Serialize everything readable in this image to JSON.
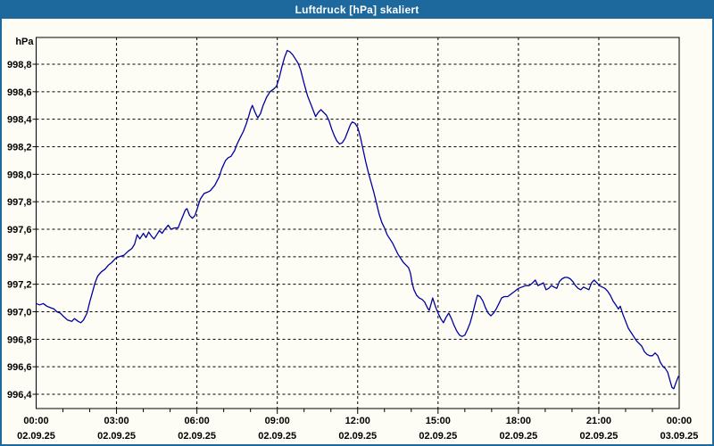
{
  "window": {
    "title": "Luftdruck [hPa] skaliert",
    "title_bar_color": "#1d699e",
    "title_text_color": "#ffffff",
    "border_color": "#1d699e",
    "background_color": "#fdfdf5"
  },
  "chart_data": {
    "type": "line",
    "title": "Luftdruck [hPa] skaliert",
    "unit_label": "hPa",
    "grid": {
      "style": "dashed",
      "color": "#000000",
      "axis_color": "#000000"
    },
    "x_axis": {
      "range_hours": [
        0,
        24
      ],
      "major_tick_hours": 3,
      "minor_tick_hours": 1,
      "ticks": [
        {
          "t": 0,
          "time": "00:00",
          "date": "02.09.25"
        },
        {
          "t": 3,
          "time": "03:00",
          "date": "02.09.25"
        },
        {
          "t": 6,
          "time": "06:00",
          "date": "02.09.25"
        },
        {
          "t": 9,
          "time": "09:00",
          "date": "02.09.25"
        },
        {
          "t": 12,
          "time": "12:00",
          "date": "02.09.25"
        },
        {
          "t": 15,
          "time": "15:00",
          "date": "02.09.25"
        },
        {
          "t": 18,
          "time": "18:00",
          "date": "02.09.25"
        },
        {
          "t": 21,
          "time": "21:00",
          "date": "02.09.25"
        },
        {
          "t": 24,
          "time": "00:00",
          "date": "03.09.25"
        }
      ]
    },
    "y_axis": {
      "grid_min": 996.4,
      "grid_max": 998.8,
      "step": 0.2,
      "plot_top_value": 999.0,
      "plot_bottom_value": 996.3,
      "ticks": [
        {
          "v": 998.8,
          "label": "998,8"
        },
        {
          "v": 998.6,
          "label": "998,6"
        },
        {
          "v": 998.4,
          "label": "998,4"
        },
        {
          "v": 998.2,
          "label": "998,2"
        },
        {
          "v": 998.0,
          "label": "998,0"
        },
        {
          "v": 997.8,
          "label": "997,8"
        },
        {
          "v": 997.6,
          "label": "997,6"
        },
        {
          "v": 997.4,
          "label": "997,4"
        },
        {
          "v": 997.2,
          "label": "997,2"
        },
        {
          "v": 997.0,
          "label": "997,0"
        },
        {
          "v": 996.8,
          "label": "996,8"
        },
        {
          "v": 996.6,
          "label": "996,6"
        },
        {
          "v": 996.4,
          "label": "996,4"
        }
      ]
    },
    "series": [
      {
        "name": "Luftdruck",
        "color": "#0000a0",
        "points": [
          [
            0.0,
            997.06
          ],
          [
            0.13,
            997.05
          ],
          [
            0.27,
            997.06
          ],
          [
            0.4,
            997.04
          ],
          [
            0.53,
            997.03
          ],
          [
            0.67,
            997.02
          ],
          [
            0.77,
            997.0
          ],
          [
            0.9,
            996.99
          ],
          [
            1.0,
            996.97
          ],
          [
            1.17,
            996.94
          ],
          [
            1.33,
            996.93
          ],
          [
            1.43,
            996.95
          ],
          [
            1.57,
            996.93
          ],
          [
            1.67,
            996.92
          ],
          [
            1.77,
            996.94
          ],
          [
            1.9,
            996.99
          ],
          [
            2.0,
            997.07
          ],
          [
            2.1,
            997.14
          ],
          [
            2.2,
            997.21
          ],
          [
            2.3,
            997.26
          ],
          [
            2.43,
            997.29
          ],
          [
            2.57,
            997.31
          ],
          [
            2.7,
            997.34
          ],
          [
            2.83,
            997.36
          ],
          [
            2.97,
            997.39
          ],
          [
            3.1,
            997.4
          ],
          [
            3.27,
            997.41
          ],
          [
            3.43,
            997.44
          ],
          [
            3.57,
            997.46
          ],
          [
            3.67,
            997.49
          ],
          [
            3.77,
            997.56
          ],
          [
            3.87,
            997.53
          ],
          [
            4.0,
            997.57
          ],
          [
            4.1,
            997.54
          ],
          [
            4.2,
            997.58
          ],
          [
            4.3,
            997.55
          ],
          [
            4.4,
            997.53
          ],
          [
            4.5,
            997.56
          ],
          [
            4.6,
            997.59
          ],
          [
            4.7,
            997.57
          ],
          [
            4.8,
            997.6
          ],
          [
            4.93,
            997.63
          ],
          [
            5.03,
            997.6
          ],
          [
            5.17,
            997.61
          ],
          [
            5.3,
            997.61
          ],
          [
            5.4,
            997.66
          ],
          [
            5.57,
            997.74
          ],
          [
            5.63,
            997.75
          ],
          [
            5.73,
            997.7
          ],
          [
            5.83,
            997.68
          ],
          [
            5.93,
            997.7
          ],
          [
            6.03,
            997.76
          ],
          [
            6.13,
            997.82
          ],
          [
            6.27,
            997.86
          ],
          [
            6.4,
            997.87
          ],
          [
            6.5,
            997.88
          ],
          [
            6.67,
            997.92
          ],
          [
            6.83,
            997.98
          ],
          [
            6.93,
            998.04
          ],
          [
            7.07,
            998.1
          ],
          [
            7.17,
            998.12
          ],
          [
            7.27,
            998.13
          ],
          [
            7.4,
            998.17
          ],
          [
            7.5,
            998.22
          ],
          [
            7.6,
            998.26
          ],
          [
            7.73,
            998.31
          ],
          [
            7.83,
            998.36
          ],
          [
            7.93,
            998.42
          ],
          [
            8.0,
            998.47
          ],
          [
            8.07,
            998.5
          ],
          [
            8.17,
            998.45
          ],
          [
            8.27,
            998.41
          ],
          [
            8.37,
            998.44
          ],
          [
            8.47,
            998.5
          ],
          [
            8.6,
            998.56
          ],
          [
            8.73,
            998.6
          ],
          [
            8.87,
            998.62
          ],
          [
            8.97,
            998.64
          ],
          [
            9.07,
            998.7
          ],
          [
            9.17,
            998.78
          ],
          [
            9.27,
            998.85
          ],
          [
            9.37,
            998.9
          ],
          [
            9.47,
            998.89
          ],
          [
            9.57,
            998.87
          ],
          [
            9.67,
            998.84
          ],
          [
            9.77,
            998.81
          ],
          [
            9.87,
            998.76
          ],
          [
            10.0,
            998.66
          ],
          [
            10.13,
            998.57
          ],
          [
            10.27,
            998.5
          ],
          [
            10.37,
            998.45
          ],
          [
            10.43,
            998.42
          ],
          [
            10.53,
            998.45
          ],
          [
            10.63,
            998.47
          ],
          [
            10.73,
            998.45
          ],
          [
            10.83,
            998.43
          ],
          [
            10.93,
            998.39
          ],
          [
            11.03,
            998.33
          ],
          [
            11.13,
            998.28
          ],
          [
            11.23,
            998.24
          ],
          [
            11.33,
            998.22
          ],
          [
            11.43,
            998.23
          ],
          [
            11.53,
            998.26
          ],
          [
            11.63,
            998.31
          ],
          [
            11.73,
            998.36
          ],
          [
            11.8,
            998.38
          ],
          [
            11.9,
            998.37
          ],
          [
            12.0,
            998.34
          ],
          [
            12.1,
            998.27
          ],
          [
            12.2,
            998.18
          ],
          [
            12.3,
            998.09
          ],
          [
            12.4,
            998.01
          ],
          [
            12.5,
            997.94
          ],
          [
            12.6,
            997.87
          ],
          [
            12.7,
            997.79
          ],
          [
            12.8,
            997.71
          ],
          [
            12.9,
            997.65
          ],
          [
            13.0,
            997.61
          ],
          [
            13.1,
            997.56
          ],
          [
            13.2,
            997.53
          ],
          [
            13.3,
            997.5
          ],
          [
            13.4,
            997.46
          ],
          [
            13.5,
            997.42
          ],
          [
            13.6,
            997.39
          ],
          [
            13.7,
            997.36
          ],
          [
            13.8,
            997.34
          ],
          [
            13.9,
            997.32
          ],
          [
            13.97,
            997.28
          ],
          [
            14.03,
            997.21
          ],
          [
            14.1,
            997.16
          ],
          [
            14.2,
            997.12
          ],
          [
            14.3,
            997.1
          ],
          [
            14.4,
            997.09
          ],
          [
            14.5,
            997.07
          ],
          [
            14.6,
            997.03
          ],
          [
            14.67,
            997.01
          ],
          [
            14.73,
            997.05
          ],
          [
            14.8,
            997.1
          ],
          [
            14.9,
            997.04
          ],
          [
            15.0,
            996.99
          ],
          [
            15.1,
            996.95
          ],
          [
            15.2,
            996.92
          ],
          [
            15.3,
            996.96
          ],
          [
            15.4,
            996.99
          ],
          [
            15.5,
            996.95
          ],
          [
            15.6,
            996.9
          ],
          [
            15.7,
            996.86
          ],
          [
            15.8,
            996.83
          ],
          [
            15.9,
            996.82
          ],
          [
            16.0,
            996.83
          ],
          [
            16.1,
            996.87
          ],
          [
            16.2,
            996.92
          ],
          [
            16.3,
            996.99
          ],
          [
            16.4,
            997.07
          ],
          [
            16.47,
            997.12
          ],
          [
            16.57,
            997.11
          ],
          [
            16.67,
            997.08
          ],
          [
            16.77,
            997.03
          ],
          [
            16.87,
            996.99
          ],
          [
            16.97,
            996.97
          ],
          [
            17.07,
            996.99
          ],
          [
            17.17,
            997.02
          ],
          [
            17.27,
            997.06
          ],
          [
            17.37,
            997.1
          ],
          [
            17.47,
            997.11
          ],
          [
            17.6,
            997.11
          ],
          [
            17.73,
            997.13
          ],
          [
            17.87,
            997.15
          ],
          [
            18.0,
            997.17
          ],
          [
            18.13,
            997.18
          ],
          [
            18.27,
            997.19
          ],
          [
            18.4,
            997.19
          ],
          [
            18.53,
            997.21
          ],
          [
            18.63,
            997.23
          ],
          [
            18.73,
            997.19
          ],
          [
            18.83,
            997.2
          ],
          [
            18.93,
            997.21
          ],
          [
            19.03,
            997.16
          ],
          [
            19.13,
            997.17
          ],
          [
            19.23,
            997.19
          ],
          [
            19.33,
            997.18
          ],
          [
            19.43,
            997.17
          ],
          [
            19.53,
            997.22
          ],
          [
            19.63,
            997.24
          ],
          [
            19.73,
            997.25
          ],
          [
            19.83,
            997.25
          ],
          [
            19.93,
            997.24
          ],
          [
            20.03,
            997.22
          ],
          [
            20.13,
            997.19
          ],
          [
            20.23,
            997.17
          ],
          [
            20.33,
            997.16
          ],
          [
            20.43,
            997.18
          ],
          [
            20.53,
            997.17
          ],
          [
            20.63,
            997.16
          ],
          [
            20.73,
            997.21
          ],
          [
            20.83,
            997.23
          ],
          [
            20.93,
            997.21
          ],
          [
            21.03,
            997.19
          ],
          [
            21.13,
            997.18
          ],
          [
            21.23,
            997.17
          ],
          [
            21.33,
            997.15
          ],
          [
            21.43,
            997.12
          ],
          [
            21.53,
            997.08
          ],
          [
            21.63,
            997.05
          ],
          [
            21.73,
            997.02
          ],
          [
            21.8,
            997.04
          ],
          [
            21.9,
            996.98
          ],
          [
            22.0,
            996.93
          ],
          [
            22.1,
            996.88
          ],
          [
            22.2,
            996.85
          ],
          [
            22.3,
            996.82
          ],
          [
            22.4,
            996.79
          ],
          [
            22.5,
            996.77
          ],
          [
            22.6,
            996.75
          ],
          [
            22.7,
            996.71
          ],
          [
            22.8,
            996.69
          ],
          [
            22.9,
            996.68
          ],
          [
            23.0,
            996.68
          ],
          [
            23.1,
            996.7
          ],
          [
            23.2,
            996.68
          ],
          [
            23.3,
            996.63
          ],
          [
            23.4,
            996.6
          ],
          [
            23.47,
            996.59
          ],
          [
            23.57,
            996.56
          ],
          [
            23.67,
            996.49
          ],
          [
            23.73,
            996.45
          ],
          [
            23.8,
            996.44
          ],
          [
            23.87,
            996.48
          ],
          [
            23.97,
            996.53
          ]
        ]
      }
    ]
  }
}
